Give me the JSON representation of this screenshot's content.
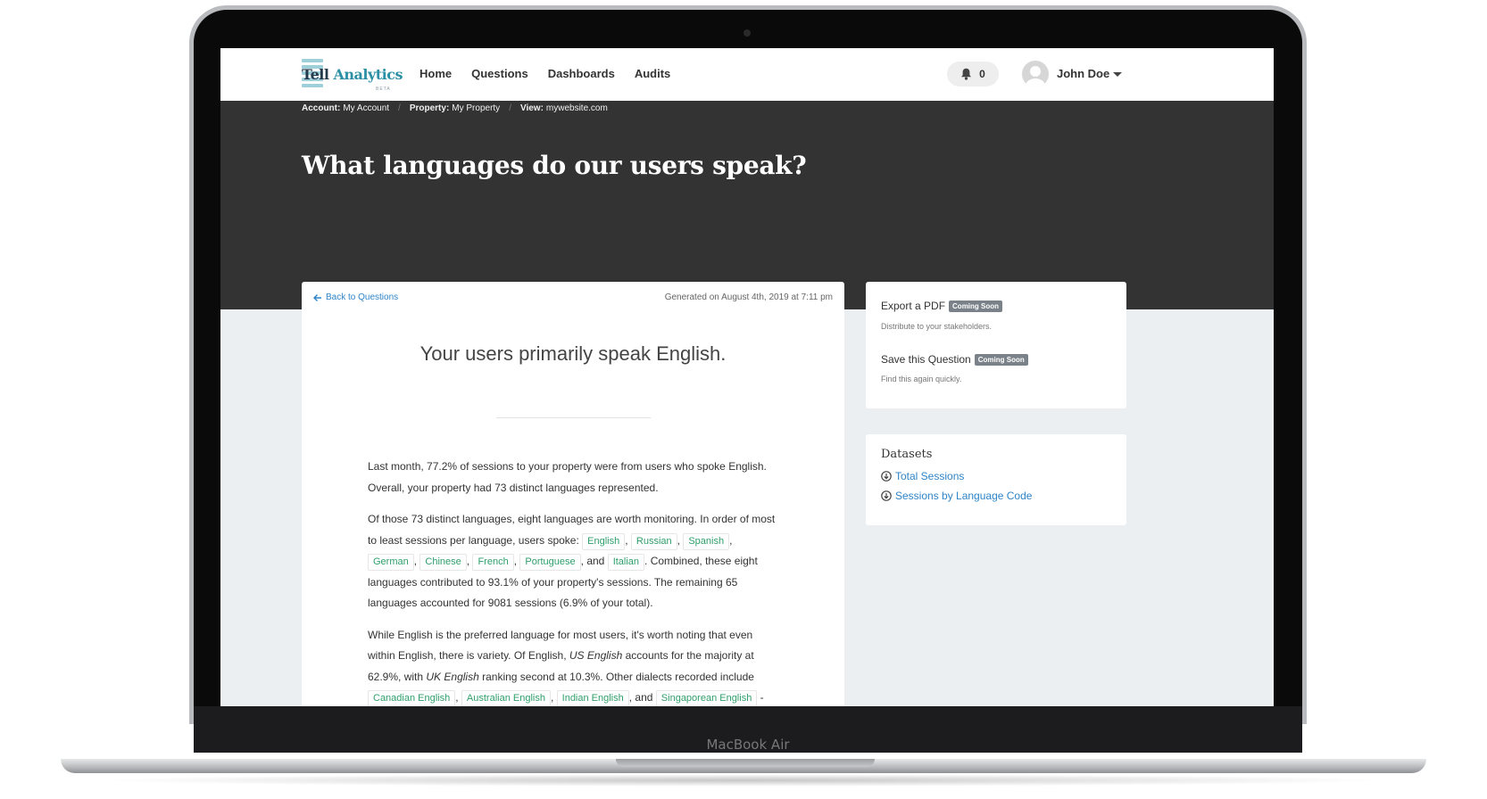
{
  "device": {
    "label": "MacBook Air"
  },
  "navbar": {
    "logo": {
      "word1": "Tell",
      "word2": "Analytics",
      "badge": "BETA"
    },
    "links": [
      {
        "label": "Home"
      },
      {
        "label": "Questions"
      },
      {
        "label": "Dashboards"
      },
      {
        "label": "Audits"
      }
    ],
    "notifications": {
      "count": "0"
    },
    "user": {
      "name": "John Doe"
    }
  },
  "breadcrumb": [
    {
      "key": "Account:",
      "value": "My Account"
    },
    {
      "key": "Property:",
      "value": "My Property"
    },
    {
      "key": "View:",
      "value": "mywebsite.com"
    }
  ],
  "page": {
    "title": "What languages do our users speak?"
  },
  "report": {
    "back_label": "Back to Questions",
    "generated": "Generated on August 4th, 2019 at 7:11 pm",
    "headline": "Your users primarily speak English.",
    "p1": "Last month, 77.2% of sessions to your property were from users who spoke English. Overall, your property had 73 distinct languages represented.",
    "p2_intro": "Of those 73 distinct languages, eight languages are worth monitoring. In order of most to least sessions per language, users spoke:",
    "languages": [
      "English",
      "Russian",
      "Spanish",
      "German",
      "Chinese",
      "French",
      "Portuguese",
      "Italian"
    ],
    "p2_and": "and",
    "p2_rest": "Combined, these eight languages contributed to 93.1% of your property's sessions. The remaining 65 languages accounted for 9081 sessions (6.9% of your total).",
    "p3_a": "While English is the preferred language for most users, it's worth noting that even within English, there is variety. Of English,",
    "p3_us": "US English",
    "p3_b": "accounts for the majority at 62.9%, with",
    "p3_uk": "UK English",
    "p3_c": "ranking second at 10.3%. Other dialects recorded include",
    "dialects": [
      "Canadian English",
      "Australian English",
      "Indian English",
      "Singaporean English"
    ],
    "p3_and": "and",
    "p3_end": "- among others."
  },
  "sidebar": {
    "export": {
      "title": "Export a PDF",
      "badge": "Coming Soon",
      "sub": "Distribute to your stakeholders."
    },
    "save": {
      "title": "Save this Question",
      "badge": "Coming Soon",
      "sub": "Find this again quickly."
    },
    "datasets": {
      "title": "Datasets",
      "items": [
        {
          "label": "Total Sessions"
        },
        {
          "label": "Sessions by Language Code"
        }
      ]
    }
  }
}
